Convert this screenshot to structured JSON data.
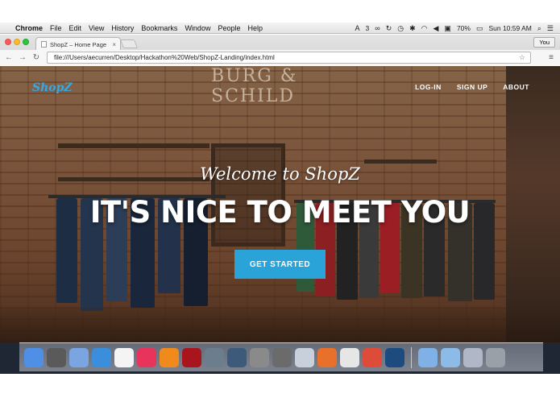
{
  "menubar": {
    "apple": "",
    "app_name": "Chrome",
    "items": [
      "File",
      "Edit",
      "View",
      "History",
      "Bookmarks",
      "Window",
      "People",
      "Help"
    ],
    "status": {
      "adobe": "3",
      "battery": "70%",
      "datetime": "Sun 10:59 AM"
    }
  },
  "browser": {
    "tab_title": "ShopZ – Home Page",
    "tab_close": "×",
    "profile_label": "You",
    "url": "file:///Users/aecurren/Desktop/Hackathon%20Web/ShopZ-Landing/index.html",
    "star": "☆",
    "menu": "≡"
  },
  "page": {
    "brand_sign": "BURG & SCHILD",
    "logo": "ShopZ",
    "nav": [
      "LOG-IN",
      "SIGN UP",
      "ABOUT"
    ],
    "welcome": "Welcome to ShopZ",
    "headline": "IT'S NICE TO MEET YOU",
    "cta_label": "GET STARTED"
  },
  "colors": {
    "accent": "#2aa3d8",
    "logo": "#3aa7e0"
  },
  "dock": {
    "icons": [
      {
        "name": "finder-icon",
        "color": "#4f8fe6"
      },
      {
        "name": "launchpad-icon",
        "color": "#5a5a5a"
      },
      {
        "name": "preview-icon",
        "color": "#7aa5e0"
      },
      {
        "name": "safari-icon",
        "color": "#3b8edb"
      },
      {
        "name": "calendar-icon",
        "color": "#f4f4f4"
      },
      {
        "name": "itunes-icon",
        "color": "#e8345d"
      },
      {
        "name": "ibooks-icon",
        "color": "#f08a1c"
      },
      {
        "name": "photobooth-icon",
        "color": "#a8151d"
      },
      {
        "name": "iphoto-icon",
        "color": "#6a7e8e"
      },
      {
        "name": "time-machine-icon",
        "color": "#3d5a7a"
      },
      {
        "name": "system-preferences-icon",
        "color": "#8a8a8a"
      },
      {
        "name": "keynote-icon",
        "color": "#6b6b6b"
      },
      {
        "name": "scripting-icon",
        "color": "#c8d0dc"
      },
      {
        "name": "firefox-icon",
        "color": "#e8702a"
      },
      {
        "name": "textedit-icon",
        "color": "#e6e6e6"
      },
      {
        "name": "chrome-icon",
        "color": "#dd4b39"
      },
      {
        "name": "sourcetree-icon",
        "color": "#1d4b80"
      }
    ],
    "right_icons": [
      {
        "name": "applications-folder-icon",
        "color": "#7fb1e6"
      },
      {
        "name": "documents-folder-icon",
        "color": "#8dbbe8"
      },
      {
        "name": "downloads-stack-icon",
        "color": "#b0b8c8"
      },
      {
        "name": "trash-icon",
        "color": "#9aa0a8"
      }
    ]
  }
}
